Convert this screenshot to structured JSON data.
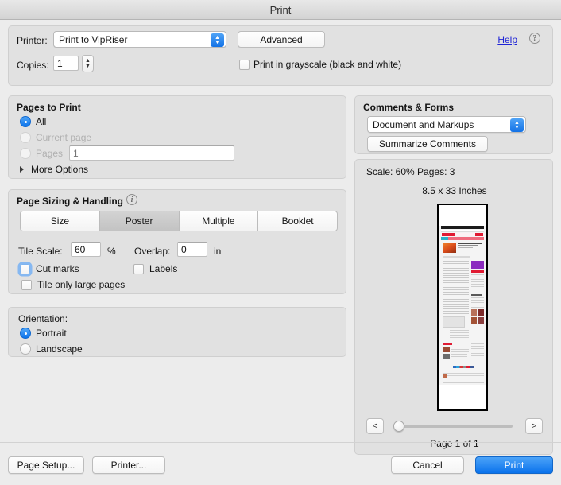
{
  "window": {
    "title": "Print"
  },
  "printer_section": {
    "printer_label": "Printer:",
    "printer_value": "Print to VipRiser",
    "advanced_label": "Advanced",
    "help_label": "Help",
    "help_icon": "question-circle-icon",
    "copies_label": "Copies:",
    "copies_value": "1",
    "stepper_icon": "stepper-up-down-icon",
    "grayscale_label": "Print in grayscale (black and white)",
    "grayscale_checked": false
  },
  "pages_to_print": {
    "title": "Pages to Print",
    "options": [
      {
        "label": "All",
        "selected": true,
        "disabled": false
      },
      {
        "label": "Current page",
        "selected": false,
        "disabled": true
      },
      {
        "label": "Pages",
        "selected": false,
        "disabled": true
      }
    ],
    "pages_input_placeholder": "1",
    "pages_input_value": "",
    "more_options_label": "More Options",
    "more_options_icon": "disclosure-triangle-right-icon"
  },
  "page_sizing": {
    "title": "Page Sizing & Handling",
    "info_icon": "info-circle-icon",
    "modes": [
      {
        "label": "Size",
        "selected": false
      },
      {
        "label": "Poster",
        "selected": true
      },
      {
        "label": "Multiple",
        "selected": false
      },
      {
        "label": "Booklet",
        "selected": false
      }
    ],
    "tile_scale_label": "Tile Scale:",
    "tile_scale_value": "60",
    "tile_scale_unit": "%",
    "overlap_label": "Overlap:",
    "overlap_value": "0",
    "overlap_unit": "in",
    "cut_marks_label": "Cut marks",
    "cut_marks_checked": false,
    "cut_marks_focused": true,
    "labels_label": "Labels",
    "labels_checked": false,
    "tile_only_large_label": "Tile only large pages",
    "tile_only_large_checked": false
  },
  "orientation": {
    "title": "Orientation:",
    "options": [
      {
        "label": "Portrait",
        "selected": true
      },
      {
        "label": "Landscape",
        "selected": false
      }
    ]
  },
  "comments_forms": {
    "title": "Comments & Forms",
    "select_value": "Document and Markups",
    "summarize_label": "Summarize Comments"
  },
  "preview": {
    "scale_line": "Scale:  60% Pages: 3",
    "size_line": "8.5 x 33 Inches",
    "page_indicator": "Page 1 of 1",
    "prev_label": "<",
    "next_label": ">",
    "slider_position_pct": 0,
    "tile_divider_count": 2
  },
  "footer": {
    "page_setup_label": "Page Setup...",
    "printer_label": "Printer...",
    "cancel_label": "Cancel",
    "print_label": "Print"
  },
  "colors": {
    "accent_blue": "#0a72ec",
    "link_blue": "#1f24d6",
    "window_bg": "#ececec",
    "group_bg": "#e1e1e1",
    "focus_ring": "#67aaf5"
  }
}
